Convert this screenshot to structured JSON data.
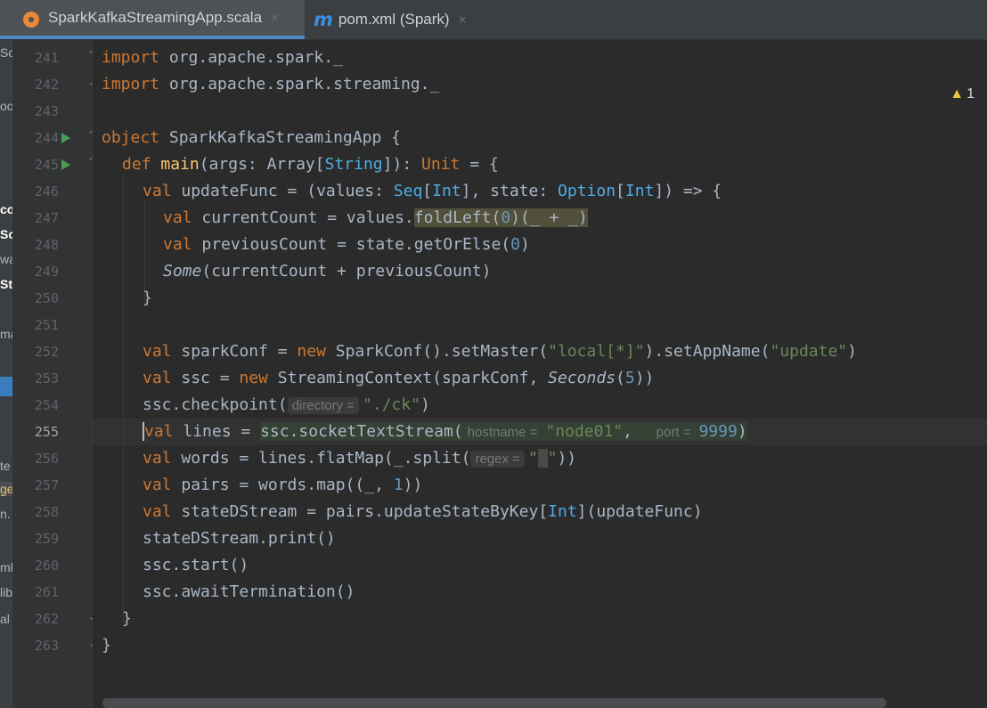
{
  "tabs": [
    {
      "label": "SparkKafkaStreamingApp.scala",
      "active": true,
      "icon": "scala-file-icon"
    },
    {
      "label": "pom.xml (Spark)",
      "active": false,
      "icon": "maven-icon"
    }
  ],
  "close_glyph": "×",
  "maven_glyph": "m",
  "warning": {
    "count": "1"
  },
  "project_strip": [
    "Sc",
    "oo",
    "co",
    "Sc",
    "wa",
    "St",
    "ma",
    "te",
    "ge",
    "n.",
    "ml",
    "lib",
    "al"
  ],
  "editor": {
    "current_line": "255",
    "lines": [
      {
        "n": "241",
        "t": "import org.apache.spark._"
      },
      {
        "n": "242",
        "t": "import org.apache.spark.streaming._"
      },
      {
        "n": "243",
        "t": ""
      },
      {
        "n": "244",
        "t": "object SparkKafkaStreamingApp {"
      },
      {
        "n": "245",
        "t": "def main(args: Array[String]): Unit = {"
      },
      {
        "n": "246",
        "t": "val updateFunc = (values: Seq[Int], state: Option[Int]) => {"
      },
      {
        "n": "247",
        "t": "val currentCount = values.foldLeft(0)(_ + _)"
      },
      {
        "n": "248",
        "t": "val previousCount = state.getOrElse(0)"
      },
      {
        "n": "249",
        "t": "Some(currentCount + previousCount)"
      },
      {
        "n": "250",
        "t": "}"
      },
      {
        "n": "251",
        "t": ""
      },
      {
        "n": "252",
        "t": "val sparkConf = new SparkConf().setMaster(\"local[*]\").setAppName(\"update\")"
      },
      {
        "n": "253",
        "t": "val ssc = new StreamingContext(sparkConf, Seconds(5))"
      },
      {
        "n": "254",
        "t": "ssc.checkpoint( directory = \"./ck\")"
      },
      {
        "n": "255",
        "t": "val lines = ssc.socketTextStream( hostname = \"node01\",  port = 9999)"
      },
      {
        "n": "256",
        "t": "val words = lines.flatMap(_.split( regex = \" \"))"
      },
      {
        "n": "257",
        "t": "val pairs = words.map((_, 1))"
      },
      {
        "n": "258",
        "t": "val stateDStream = pairs.updateStateByKey[Int](updateFunc)"
      },
      {
        "n": "259",
        "t": "stateDStream.print()"
      },
      {
        "n": "260",
        "t": "ssc.start()"
      },
      {
        "n": "261",
        "t": "ssc.awaitTermination()"
      },
      {
        "n": "262",
        "t": "}"
      },
      {
        "n": "263",
        "t": "}"
      }
    ],
    "hints": {
      "directory": "directory =",
      "hostname": "hostname =",
      "port": "port =",
      "regex": "regex ="
    }
  },
  "colors": {
    "background": "#2b2b2b",
    "gutter": "#313335",
    "keyword": "#cc7832",
    "function": "#ffc66d",
    "type": "#4eade5",
    "string": "#6a8759",
    "number": "#6897bb",
    "tab_underline": "#4a88c7"
  }
}
